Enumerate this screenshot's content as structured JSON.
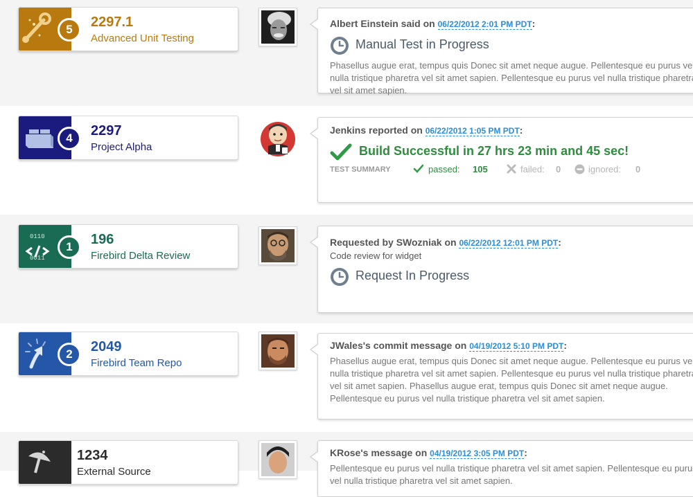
{
  "feed": [
    {
      "card": {
        "number": "2297.1",
        "name": "Advanced Unit Testing",
        "badge": "5",
        "color": "#b8790f",
        "icon": "wrench-icon"
      },
      "avatar": "einstein-avatar",
      "header": {
        "actor": "Albert Einstein said on",
        "timestamp": "06/22/2012 2:01 PM PDT",
        "suffix": ":"
      },
      "status": {
        "text": "Manual Test in Progress",
        "icon": "clock-icon"
      },
      "body": "Phasellus augue erat, tempus quis Donec sit amet neque augue. Pellentesque eu purus vel nulla tristique pharetra vel sit amet sapien. Pellentesque eu purus vel nulla tristique pharetra vel sit amet sapien."
    },
    {
      "card": {
        "number": "2297",
        "name": "Project Alpha",
        "badge": "4",
        "color": "#1b1b7e",
        "icon": "lego-brick-icon"
      },
      "avatar": "jenkins-avatar",
      "header": {
        "actor": "Jenkins reported on",
        "timestamp": "06/22/2012 1:05 PM PDT",
        "suffix": ":"
      },
      "status": {
        "text": "Build Successful in 27 hrs 23 min and 45 sec!",
        "icon": "checkmark-icon"
      },
      "summary": {
        "label": "TEST SUMMARY",
        "passed_label": "passed:",
        "passed": "105",
        "failed_label": "failed:",
        "failed": "0",
        "ignored_label": "ignored:",
        "ignored": "0"
      }
    },
    {
      "card": {
        "number": "196",
        "name": "Firebird Delta Review",
        "badge": "1",
        "color": "#1a6b53",
        "icon": "code-review-icon",
        "icon_text_top": "0110",
        "icon_text_bottom": "0011"
      },
      "avatar": "swozniak-avatar",
      "header": {
        "actor": "Requested by SWozniak on",
        "timestamp": "06/22/2012 12:01 PM PDT",
        "suffix": ":"
      },
      "subline": "Code review for widget",
      "status": {
        "text": "Request In Progress",
        "icon": "clock-icon"
      }
    },
    {
      "card": {
        "number": "2049",
        "name": "Firebird Team Repo",
        "badge": "2",
        "color": "#2457a8",
        "icon": "repo-arrow-icon"
      },
      "avatar": "jwales-avatar",
      "header": {
        "actor": "JWales's commit message on",
        "timestamp": "04/19/2012 5:10 PM PDT",
        "suffix": ":"
      },
      "body": "Phasellus augue erat, tempus quis Donec sit amet neque augue. Pellentesque eu purus vel nulla tristique pharetra vel sit amet sapien. Pellentesque eu purus vel nulla tristique pharetra vel sit amet sapien. Phasellus augue erat, tempus quis Donec sit amet neque augue. Pellentesque eu purus vel nulla tristique pharetra vel sit amet sapien."
    },
    {
      "card": {
        "number": "1234",
        "name": "External Source",
        "color": "#2b2b2b",
        "icon": "satellite-dish-icon"
      },
      "avatar": "krose-avatar",
      "header": {
        "actor": "KRose's message on",
        "timestamp": "04/19/2012 3:05 PM PDT",
        "suffix": ":"
      },
      "body": "Pellentesque eu purus vel nulla tristique pharetra vel sit amet sapien. Pellentesque eu purus vel nulla tristique pharetra vel sit amet sapien."
    }
  ]
}
